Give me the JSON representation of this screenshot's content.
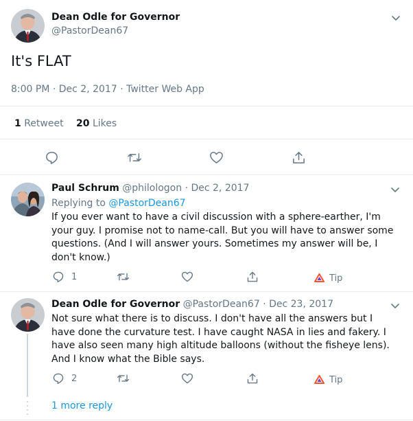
{
  "main_tweet": {
    "author_name": "Dean Odle for Governor",
    "author_handle": "@PastorDean67",
    "text": "It's FLAT",
    "timestamp": "8:00 PM · Dec 2, 2017 · Twitter Web App",
    "retweet_count": "1",
    "retweet_label": "Retweet",
    "like_count": "20",
    "like_label": "Likes"
  },
  "replies": [
    {
      "author_name": "Paul Schrum",
      "author_handle": "@philologon",
      "date": "· Dec 2, 2017",
      "replying_prefix": "Replying to",
      "replying_to": "@PastorDean67",
      "text": "If you ever want to have a civil discussion with a sphere-earther, I'm your guy. I promise not to name-call. But you will have to answer some questions. (And I will answer yours. Sometimes my answer will be, I don't know.)",
      "reply_count": "1",
      "tip_label": "Tip"
    },
    {
      "author_name": "Dean Odle for Governor",
      "author_handle": "@PastorDean67",
      "date": "· Dec 23, 2017",
      "text": "Not sure what there is to discuss. I don't have all the answers but I have done the curvature test. I have caught NASA in lies and fakery. I have also seen many high altitude balloons (without the fisheye lens). And I know what the Bible says.",
      "reply_count": "2",
      "tip_label": "Tip"
    }
  ],
  "more_replies_label": "1 more reply",
  "colors": {
    "text": "#14171a",
    "muted": "#657786",
    "link": "#1b95e0",
    "border": "#e6ecf0",
    "tip_brave": "#fb542b"
  }
}
